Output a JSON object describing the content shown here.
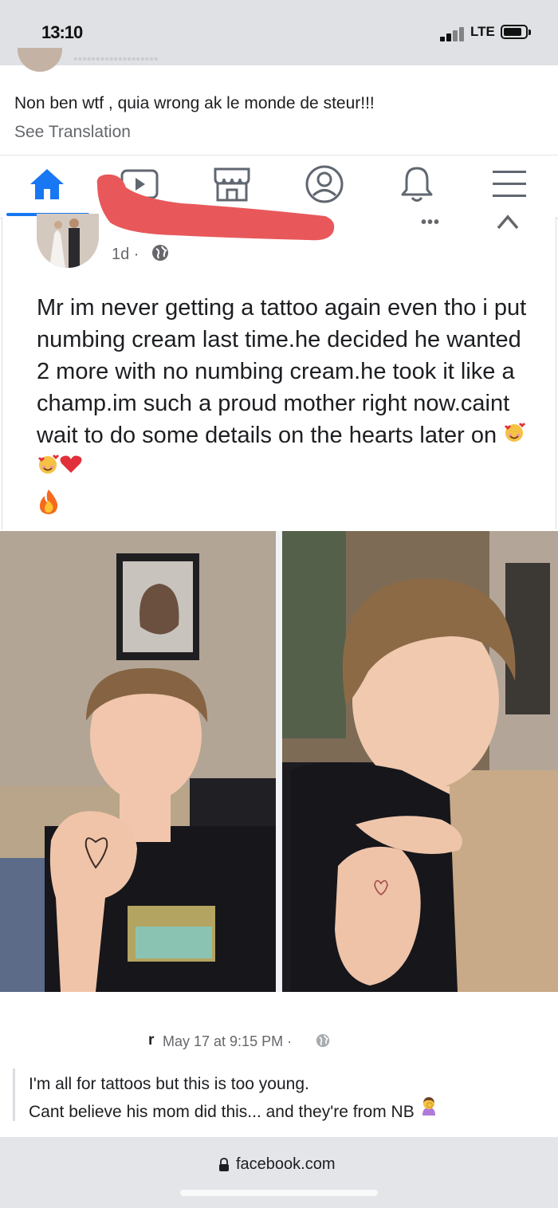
{
  "status_bar": {
    "time": "13:10",
    "network": "LTE",
    "icons": [
      "signal-icon",
      "battery-icon"
    ]
  },
  "top_comment": {
    "text": "Non ben wtf , quia wrong ak le monde de steur!!!",
    "see_translation": "See Translation"
  },
  "nav": {
    "items": [
      "home-icon",
      "video-icon",
      "marketplace-icon",
      "profile-icon",
      "notifications-icon",
      "menu-icon"
    ],
    "active": "home-icon",
    "accent": "#1877f2"
  },
  "post": {
    "time": "1d ·",
    "text": "Mr im never getting a tattoo again even tho i put numbing cream last time.he decided he wanted 2 more with no numbing cream.he took it like a champ.im such a proud mother right now.caint wait to do some details on the hearts later on",
    "emojis": [
      "smiling-face-with-hearts-icon",
      "smiling-face-with-hearts-icon",
      "heart-icon",
      "fire-icon"
    ]
  },
  "comment": {
    "name_suffix": "r",
    "meta": "May 17 at 9:15 PM ·",
    "line1": "I'm all for tattoos but this is too young.",
    "line2": "Cant believe his mom did this... and they're from NB"
  },
  "browser": {
    "domain": "facebook.com"
  },
  "colors": {
    "redaction": "#e8585a",
    "link_gray": "#65676b"
  }
}
